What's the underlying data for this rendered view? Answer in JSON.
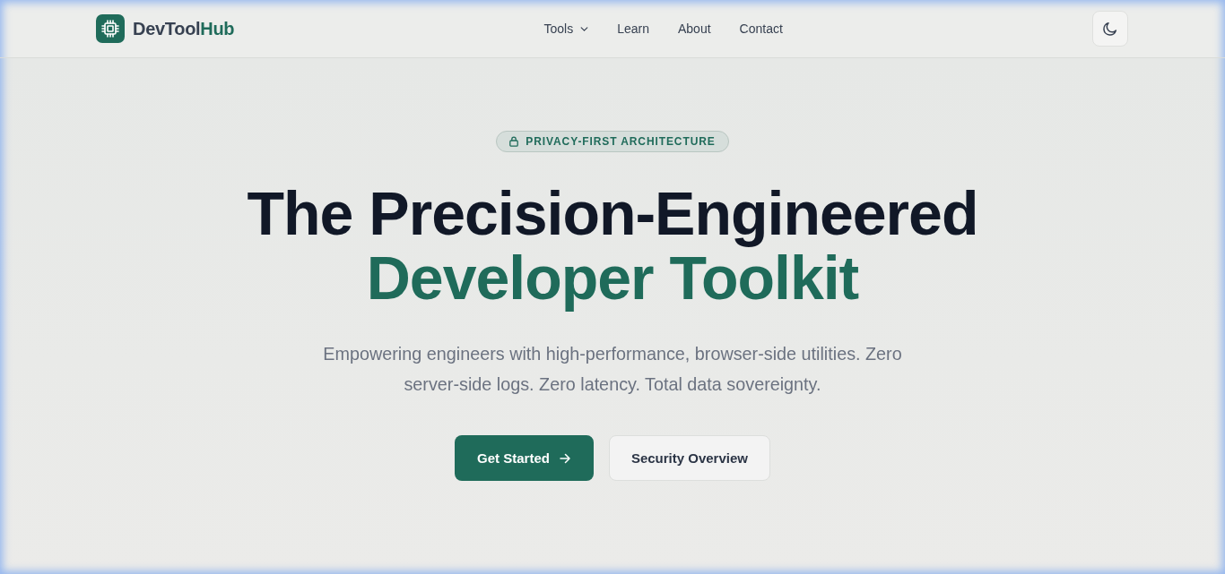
{
  "header": {
    "logo": {
      "name": "DevTool",
      "accent": "Hub"
    },
    "nav": [
      {
        "label": "Tools",
        "kind": "dropdown"
      },
      {
        "label": "Learn",
        "kind": "link"
      },
      {
        "label": "About",
        "kind": "link"
      },
      {
        "label": "Contact",
        "kind": "link"
      }
    ]
  },
  "hero": {
    "badge": "PRIVACY-FIRST ARCHITECTURE",
    "headline": {
      "line_1": "The Precision-Engineered",
      "line_2": "Developer Toolkit"
    },
    "subtitle": "Empowering engineers with high-performance, browser-side utilities. Zero server-side logs. Zero latency. Total data sovereignty.",
    "buttons": [
      {
        "label": "Get Started",
        "kind": "primary"
      },
      {
        "label": "Security Overview",
        "kind": "secondary"
      }
    ]
  }
}
